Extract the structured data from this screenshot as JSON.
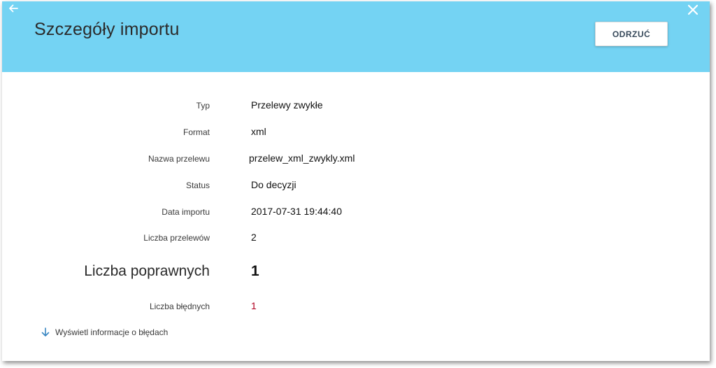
{
  "header": {
    "title": "Szczegóły importu",
    "reject_button": "ODRZUĆ",
    "back_icon": "arrow-left-icon",
    "close_icon": "close-icon",
    "background_color": "#74d3f3"
  },
  "details": {
    "type_label": "Typ",
    "type_value": "Przelewy zwykłe",
    "format_label": "Format",
    "format_value": "xml",
    "name_label": "Nazwa przelewu",
    "name_value": "przelew_xml_zwykly.xml",
    "status_label": "Status",
    "status_value": "Do decyzji",
    "date_label": "Data importu",
    "date_value": "2017-07-31 19:44:40",
    "count_label": "Liczba przelewów",
    "count_value": "2",
    "valid_label": "Liczba poprawnych",
    "valid_value": "1",
    "invalid_label": "Liczba błędnych",
    "invalid_value": "1",
    "invalid_color": "#b00020"
  },
  "footer": {
    "errors_link": "Wyświetl informacje o błędach",
    "errors_icon": "arrow-down-icon"
  }
}
